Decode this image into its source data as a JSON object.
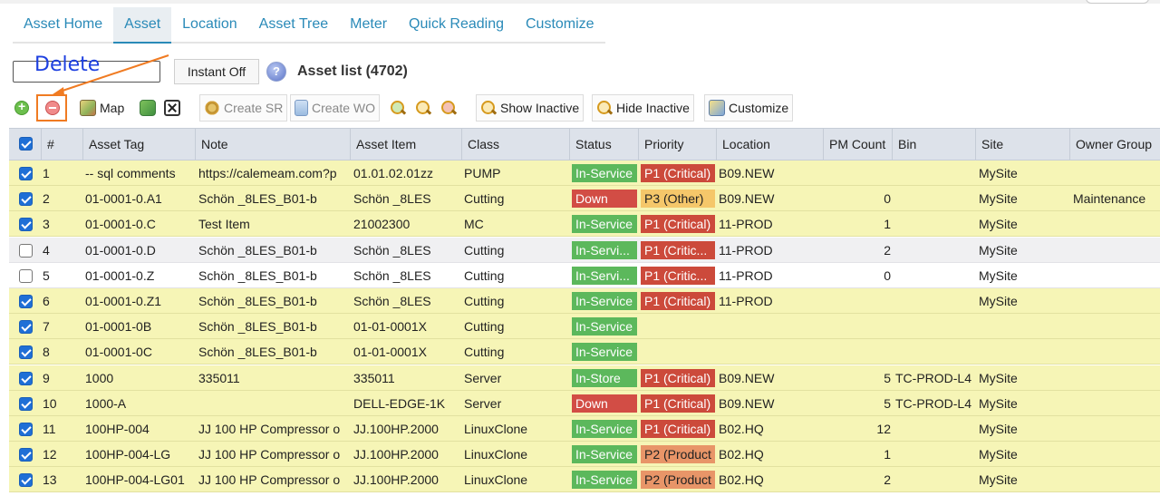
{
  "tabs": [
    {
      "label": "Asset Home",
      "active": false
    },
    {
      "label": "Asset",
      "active": true
    },
    {
      "label": "Location",
      "active": false
    },
    {
      "label": "Asset Tree",
      "active": false
    },
    {
      "label": "Meter",
      "active": false
    },
    {
      "label": "Quick Reading",
      "active": false
    },
    {
      "label": "Customize",
      "active": false
    }
  ],
  "annotation": {
    "label": "Delete",
    "color": "#1e40e0",
    "arrow_color": "#f07b22"
  },
  "search": {
    "value": ""
  },
  "instant_button": {
    "label": "Instant Off"
  },
  "help_icon": "question-icon",
  "list_title": "Asset list (4702)",
  "toolbar": {
    "add_icon": "add-circle-icon",
    "delete_icon": "delete-circle-icon",
    "map_label": "Map",
    "refresh_icon": "refresh-icon",
    "clear_icon": "clear-x-icon",
    "create_sr_label": "Create SR",
    "create_wo_label": "Create WO",
    "show_inactive_label": "Show Inactive",
    "hide_inactive_label": "Hide Inactive",
    "customize_label": "Customize"
  },
  "columns": {
    "num": "#",
    "asset_tag": "Asset Tag",
    "note": "Note",
    "asset_item": "Asset Item",
    "class": "Class",
    "status": "Status",
    "priority": "Priority",
    "location": "Location",
    "pm_count": "PM Count",
    "bin": "Bin",
    "site": "Site",
    "owner_group": "Owner Group"
  },
  "colors": {
    "selected_row": "#f6f5b6",
    "status_green": "#5cb85c",
    "status_red": "#d24d45",
    "p1": "#cc4a3b",
    "p2": "#e89568",
    "p3": "#f5c76a"
  },
  "rows": [
    {
      "num": "1",
      "checked": true,
      "tag": "-- sql comments",
      "note": "https://calemeam.com?p",
      "item": "01.01.02.01zz",
      "class": "PUMP",
      "status": "In-Service",
      "status_kind": "inservice",
      "priority": "P1 (Critical)",
      "priority_kind": "p1",
      "location": "B09.NEW",
      "pm": "",
      "bin": "",
      "site": "MySite",
      "owner": ""
    },
    {
      "num": "2",
      "checked": true,
      "tag": "01-0001-0.A1",
      "note": "Schön _8LES_B01-b",
      "item": "Schön _8LES",
      "class": "Cutting",
      "status": "Down",
      "status_kind": "down",
      "priority": "P3 (Other)",
      "priority_kind": "p3",
      "location": "B09.NEW",
      "pm": "0",
      "bin": "",
      "site": "MySite",
      "owner": "Maintenance"
    },
    {
      "num": "3",
      "checked": true,
      "tag": "01-0001-0.C",
      "note": "Test Item",
      "item": "21002300",
      "class": "MC",
      "status": "In-Service",
      "status_kind": "inservice",
      "priority": "P1 (Critical)",
      "priority_kind": "p1",
      "location": "11-PROD",
      "pm": "1",
      "bin": "",
      "site": "MySite",
      "owner": ""
    },
    {
      "num": "4",
      "checked": false,
      "tag": "01-0001-0.D",
      "note": "Schön _8LES_B01-b",
      "item": "Schön _8LES",
      "class": "Cutting",
      "status": "In-Servi...",
      "status_kind": "inservice",
      "priority": "P1 (Critic...",
      "priority_kind": "p1",
      "location": "11-PROD",
      "pm": "2",
      "bin": "",
      "site": "MySite",
      "owner": ""
    },
    {
      "num": "5",
      "checked": false,
      "tag": "01-0001-0.Z",
      "note": "Schön _8LES_B01-b",
      "item": "Schön _8LES",
      "class": "Cutting",
      "status": "In-Servi...",
      "status_kind": "inservice",
      "priority": "P1 (Critic...",
      "priority_kind": "p1",
      "location": "11-PROD",
      "pm": "0",
      "bin": "",
      "site": "MySite",
      "owner": ""
    },
    {
      "num": "6",
      "checked": true,
      "tag": "01-0001-0.Z1",
      "note": "Schön _8LES_B01-b",
      "item": "Schön _8LES",
      "class": "Cutting",
      "status": "In-Service",
      "status_kind": "inservice",
      "priority": "P1 (Critical)",
      "priority_kind": "p1",
      "location": "11-PROD",
      "pm": "",
      "bin": "",
      "site": "MySite",
      "owner": ""
    },
    {
      "num": "7",
      "checked": true,
      "tag": "01-0001-0B",
      "note": "Schön _8LES_B01-b",
      "item": "01-01-0001X",
      "class": "Cutting",
      "status": "In-Service",
      "status_kind": "inservice",
      "priority": "",
      "priority_kind": "",
      "location": "",
      "pm": "",
      "bin": "",
      "site": "",
      "owner": ""
    },
    {
      "num": "8",
      "checked": true,
      "tag": "01-0001-0C",
      "note": "Schön _8LES_B01-b",
      "item": "01-01-0001X",
      "class": "Cutting",
      "status": "In-Service",
      "status_kind": "inservice",
      "priority": "",
      "priority_kind": "",
      "location": "",
      "pm": "",
      "bin": "",
      "site": "",
      "owner": ""
    },
    {
      "num": "9",
      "checked": true,
      "tag": "1000",
      "note": "335011",
      "item": "335011",
      "class": "Server",
      "status": "In-Store",
      "status_kind": "instore",
      "priority": "P1 (Critical)",
      "priority_kind": "p1",
      "location": "B09.NEW",
      "pm": "5",
      "bin": "TC-PROD-L4",
      "site": "MySite",
      "owner": ""
    },
    {
      "num": "10",
      "checked": true,
      "tag": "1000-A",
      "note": "",
      "item": "DELL-EDGE-1K",
      "class": "Server",
      "status": "Down",
      "status_kind": "down",
      "priority": "P1 (Critical)",
      "priority_kind": "p1",
      "location": "B09.NEW",
      "pm": "5",
      "bin": "TC-PROD-L4",
      "site": "MySite",
      "owner": ""
    },
    {
      "num": "11",
      "checked": true,
      "tag": "100HP-004",
      "note": "JJ 100 HP Compressor o",
      "item": "JJ.100HP.2000",
      "class": "LinuxClone",
      "status": "In-Service",
      "status_kind": "inservice",
      "priority": "P1 (Critical)",
      "priority_kind": "p1",
      "location": "B02.HQ",
      "pm": "12",
      "bin": "",
      "site": "MySite",
      "owner": ""
    },
    {
      "num": "12",
      "checked": true,
      "tag": "100HP-004-LG",
      "note": "JJ 100 HP Compressor o",
      "item": "JJ.100HP.2000",
      "class": "LinuxClone",
      "status": "In-Service",
      "status_kind": "inservice",
      "priority": "P2 (Product",
      "priority_kind": "p2",
      "location": "B02.HQ",
      "pm": "1",
      "bin": "",
      "site": "MySite",
      "owner": ""
    },
    {
      "num": "13",
      "checked": true,
      "tag": "100HP-004-LG01",
      "note": "JJ 100 HP Compressor o",
      "item": "JJ.100HP.2000",
      "class": "LinuxClone",
      "status": "In-Service",
      "status_kind": "inservice",
      "priority": "P2 (Product",
      "priority_kind": "p2",
      "location": "B02.HQ",
      "pm": "2",
      "bin": "",
      "site": "MySite",
      "owner": ""
    }
  ]
}
